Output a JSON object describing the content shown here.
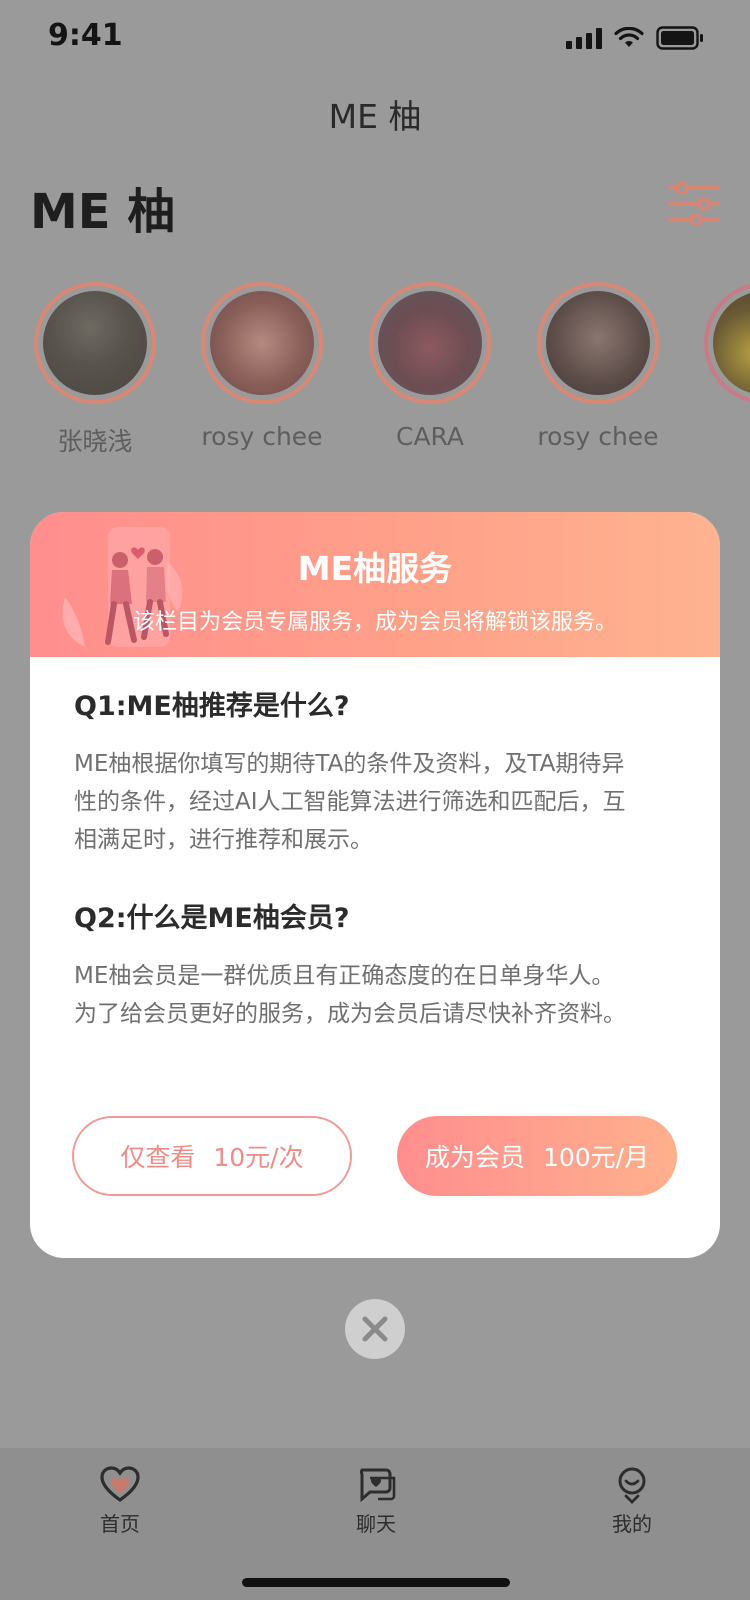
{
  "status_bar": {
    "time": "9:41"
  },
  "header": {
    "nav_title": "ME 柚",
    "page_title": "ME 柚"
  },
  "avatars": [
    {
      "name": "张晓浅"
    },
    {
      "name": "rosy chee"
    },
    {
      "name": "CARA"
    },
    {
      "name": "rosy chee"
    }
  ],
  "modal": {
    "title": "ME柚服务",
    "subtitle": "该栏目为会员专属服务，成为会员将解锁该服务。",
    "q1": {
      "title": "Q1:ME柚推荐是什么?",
      "lines": [
        "ME柚根据你填写的期待TA的条件及资料，及TA期待异",
        "性的条件，经过AI人工智能算法进行筛选和匹配后，互",
        "相满足时，进行推荐和展示。"
      ]
    },
    "q2": {
      "title": "Q2:什么是ME柚会员?",
      "lines": [
        "ME柚会员是一群优质且有正确态度的在日单身华人。",
        "为了给会员更好的服务，成为会员后请尽快补齐资料。"
      ]
    },
    "buttons": {
      "view_once": {
        "label": "仅查看",
        "price": "10元/次"
      },
      "become_member": {
        "label": "成为会员",
        "price": "100元/月"
      }
    }
  },
  "tabs": [
    {
      "label": "首页"
    },
    {
      "label": "聊天"
    },
    {
      "label": "我的"
    }
  ],
  "colors": {
    "accent": "#ff8e8e",
    "accent_end": "#ffb08d",
    "overlay_bg": "#9a9a9a"
  }
}
